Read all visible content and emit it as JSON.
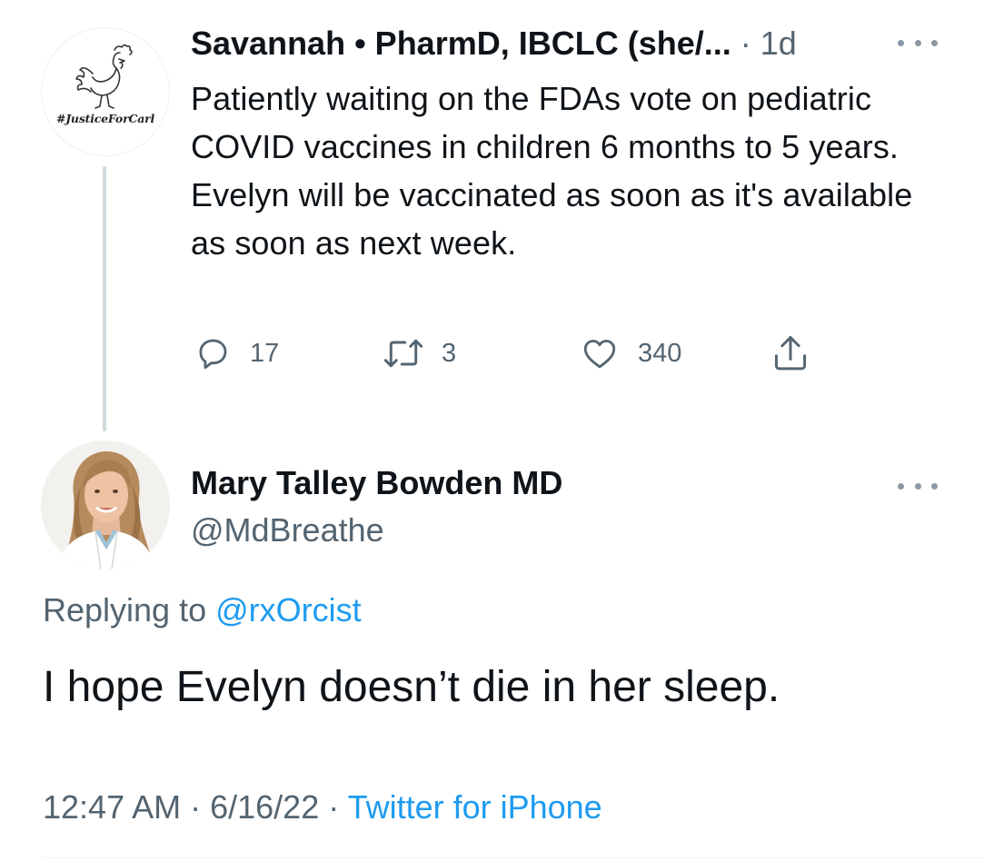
{
  "tweet1": {
    "avatar_hashtag": "#JusticeForCarl",
    "display_name": "Savannah • PharmD, IBCLC (she/...",
    "time": " · 1d",
    "text": "Patiently waiting on the FDAs vote on pediatric COVID vaccines in children 6 months to 5 years. Evelyn will be vaccinated as soon as it's available as soon as next week.",
    "actions": {
      "replies": "17",
      "retweets": "3",
      "likes": "340"
    },
    "icons": [
      "reply-icon",
      "retweet-icon",
      "like-icon",
      "share-icon",
      "more-icon"
    ]
  },
  "tweet2": {
    "display_name": "Mary Talley Bowden MD",
    "handle": "@MdBreathe",
    "replying_prefix": "Replying to ",
    "replying_to": "@rxOrcist",
    "text": "I hope Evelyn doesn’t die in her sleep.",
    "time": "12:47 AM",
    "date_sep": " · ",
    "date": "6/16/22",
    "source_sep": " · ",
    "source": "Twitter for iPhone"
  },
  "colors": {
    "text_primary": "#0f1419",
    "text_secondary": "#536471",
    "link_blue": "#1d9bf0",
    "thread_line": "#cfd9de"
  }
}
